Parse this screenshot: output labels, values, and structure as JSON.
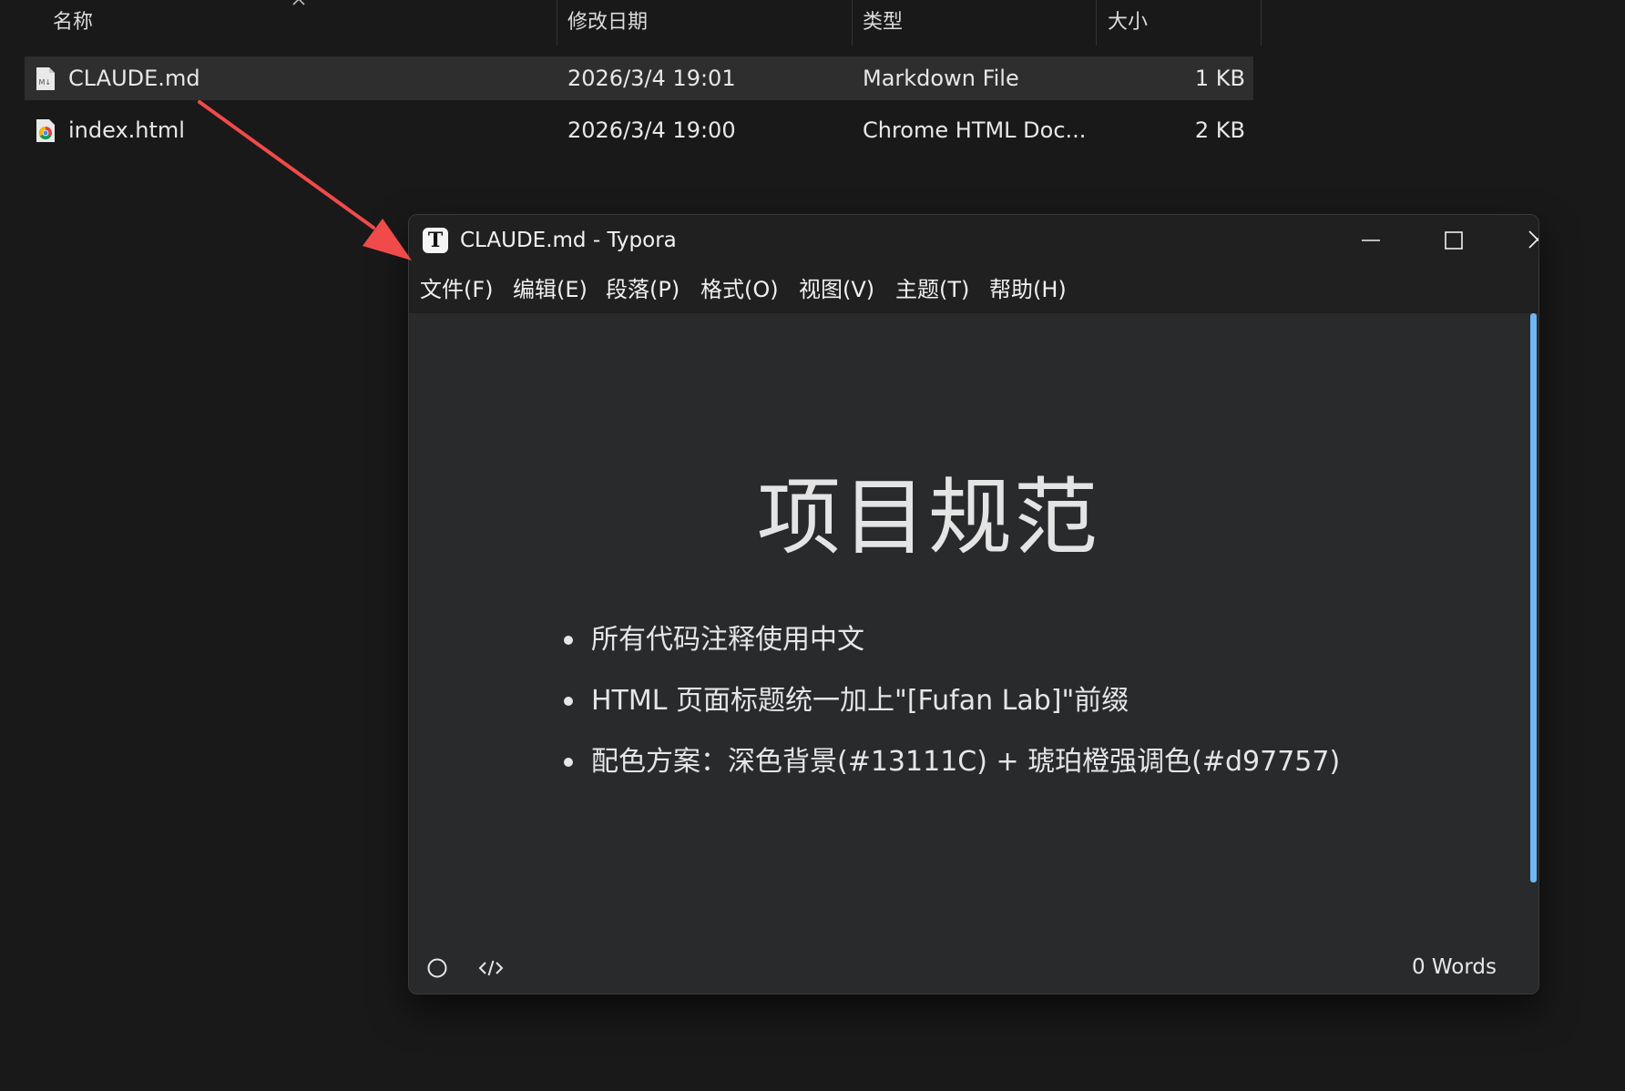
{
  "explorer": {
    "columns": {
      "name": "名称",
      "modified": "修改日期",
      "type": "类型",
      "size": "大小"
    },
    "files": [
      {
        "name": "CLAUDE.md",
        "modified": "2026/3/4 19:01",
        "type": "Markdown File",
        "size": "1 KB",
        "icon": "markdown-file-icon",
        "selected": true
      },
      {
        "name": "index.html",
        "modified": "2026/3/4 19:00",
        "type": "Chrome HTML Doc...",
        "size": "2 KB",
        "icon": "chrome-html-file-icon",
        "selected": false
      }
    ]
  },
  "annotation": {
    "arrow_color": "#f04a4a"
  },
  "typora": {
    "app_icon_letter": "T",
    "title": "CLAUDE.md - Typora",
    "menu": [
      "文件(F)",
      "编辑(E)",
      "段落(P)",
      "格式(O)",
      "视图(V)",
      "主题(T)",
      "帮助(H)"
    ],
    "document": {
      "heading": "项目规范",
      "bullets": [
        "所有代码注释使用中文",
        "HTML 页面标题统一加上\"[Fufan Lab]\"前缀",
        "配色方案：深色背景(#13111C) + 琥珀橙强调色(#d97757)"
      ]
    },
    "status": {
      "word_count": "0 Words"
    },
    "scrollbar_color": "#6fb6f2"
  }
}
